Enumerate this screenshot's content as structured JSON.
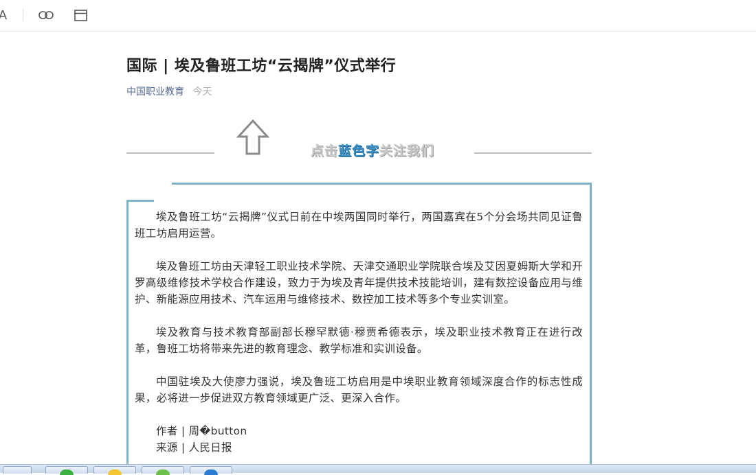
{
  "toolbar": {
    "font_glyph": "A",
    "icons": [
      "font-size-icon",
      "link-icon",
      "window-icon"
    ]
  },
  "article": {
    "title": "国际 | 埃及鲁班工坊“云揭牌”仪式举行",
    "account": "中国职业教育",
    "time": "今天"
  },
  "follow_banner": {
    "prefix": "点击",
    "highlight": "蓝色字",
    "suffix": "关注我们",
    "icon": "up-arrow-icon"
  },
  "content": {
    "paragraphs": [
      "埃及鲁班工坊“云揭牌”仪式日前在中埃两国同时举行，两国嘉宾在5个分会场共同见证鲁班工坊启用运营。",
      "埃及鲁班工坊由天津轻工职业技术学院、天津交通职业学院联合埃及艾因夏姆斯大学和开罗高级维修技术学校合作建设，致力于为埃及青年提供技术技能培训，建有数控设备应用与维护、新能源应用技术、汽车运用与维修技术、数控加工技术等多个专业实训室。",
      "埃及教育与技术教育部副部长穆罕默德·穆贾希德表示，埃及职业技术教育正在进行改革，鲁班工坊将带来先进的教育理念、教学标准和实训设备。",
      "中国驻埃及大使廖力强说，埃及鲁班工坊启用是中埃职业教育领域深度合作的标志性成果，必将进一步促进双方教育领域更广泛、更深入合作。"
    ],
    "author": "作者 | 周�button",
    "source": "来源 | 人民日报"
  },
  "colors": {
    "accent_link": "#576b95",
    "frame": "#7fb2c5",
    "highlight_blue": "#3b8fc4"
  }
}
